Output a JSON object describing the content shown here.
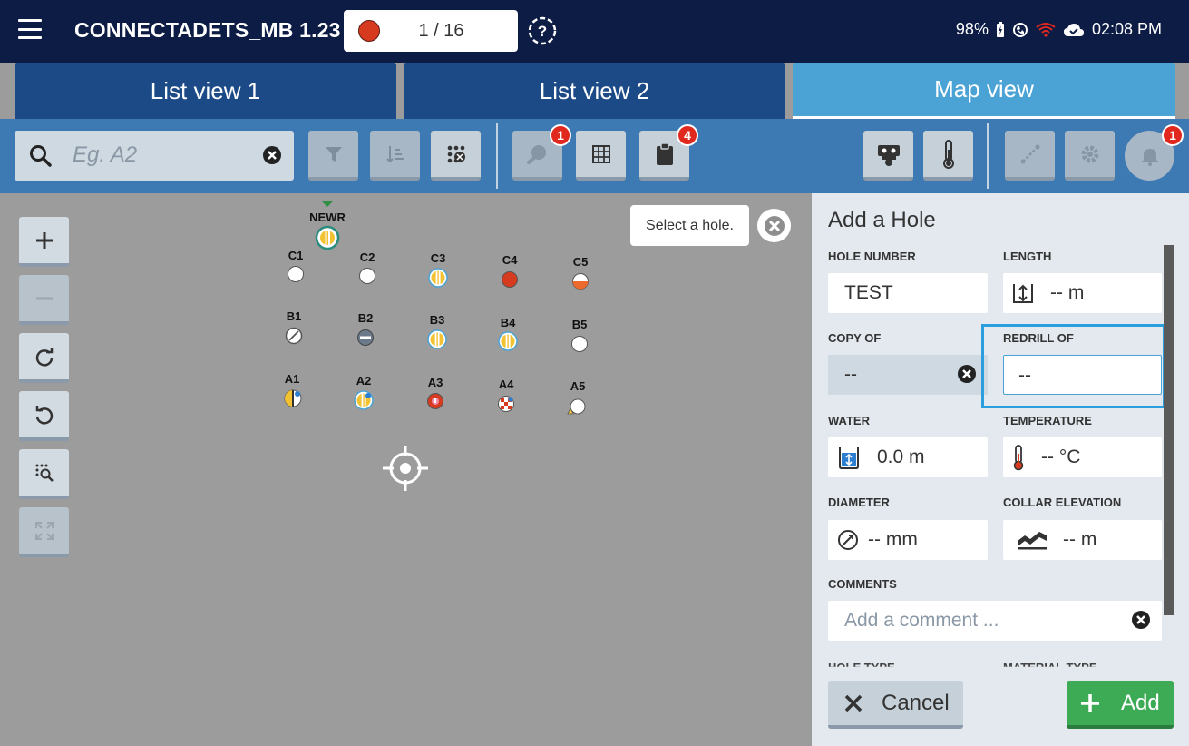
{
  "app": {
    "title": "CONNECTADETS_MB 1.23",
    "counter": "1 / 16",
    "status": {
      "battery": "98%",
      "time": "02:08 PM"
    }
  },
  "tabs": [
    {
      "label": "List view 1"
    },
    {
      "label": "List view 2"
    },
    {
      "label": "Map view",
      "active": true
    }
  ],
  "toolbar": {
    "search_placeholder": "Eg. A2",
    "badges": {
      "marker": "1",
      "clipboard": "4",
      "notifications": "1"
    }
  },
  "map": {
    "tooltip": "Select a hole.",
    "holes": [
      {
        "label": "NEWR",
        "style": "yellow-stripes-ring"
      },
      {
        "label": "C1",
        "style": "white"
      },
      {
        "label": "C2",
        "style": "white"
      },
      {
        "label": "C3",
        "style": "yellow-stripes"
      },
      {
        "label": "C4",
        "style": "red"
      },
      {
        "label": "C5",
        "style": "orange-half"
      },
      {
        "label": "B1",
        "style": "slash"
      },
      {
        "label": "B2",
        "style": "minus"
      },
      {
        "label": "B3",
        "style": "yellow-stripes"
      },
      {
        "label": "B4",
        "style": "yellow-stripes-blue"
      },
      {
        "label": "B5",
        "style": "white"
      },
      {
        "label": "A1",
        "style": "yellow-blue"
      },
      {
        "label": "A2",
        "style": "yellow-blue"
      },
      {
        "label": "A3",
        "style": "red-pink"
      },
      {
        "label": "A4",
        "style": "checker"
      },
      {
        "label": "A5",
        "style": "white-warning"
      }
    ]
  },
  "panel": {
    "title": "Add a Hole",
    "fields": {
      "hole_number": {
        "label": "HOLE NUMBER",
        "value": "TEST"
      },
      "length": {
        "label": "LENGTH",
        "value": "--  m"
      },
      "copy_of": {
        "label": "COPY OF",
        "value": "--"
      },
      "redrill_of": {
        "label": "REDRILL OF",
        "value": "--"
      },
      "water": {
        "label": "WATER",
        "value": "0.0  m"
      },
      "temperature": {
        "label": "TEMPERATURE",
        "value": "-- °C"
      },
      "diameter": {
        "label": "DIAMETER",
        "value": "-- mm"
      },
      "collar_elevation": {
        "label": "COLLAR ELEVATION",
        "value": "-- m"
      },
      "comments": {
        "label": "COMMENTS",
        "placeholder": "Add a comment ..."
      }
    },
    "cut_labels": {
      "left": "HOLE TYPE",
      "right": "MATERIAL TYPE"
    },
    "cancel_label": "Cancel",
    "add_label": "Add"
  },
  "colors": {
    "topbar": "#0c1c44",
    "tab": "#1b4a86",
    "tab_active": "#4aa3d4",
    "toolbar": "#3d79b2",
    "accent_green": "#3daa56",
    "badge_red": "#e0281e"
  }
}
